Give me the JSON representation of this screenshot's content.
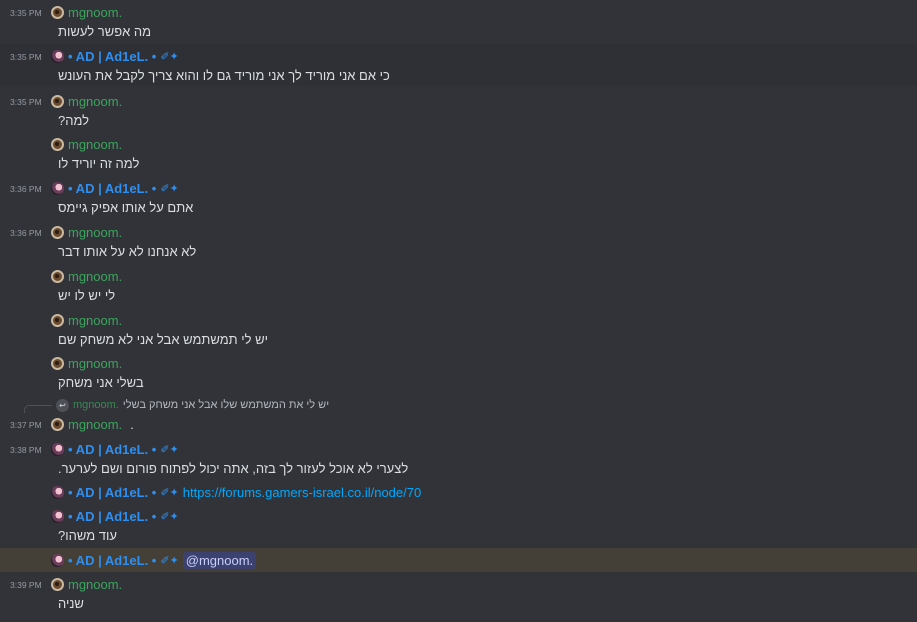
{
  "users": {
    "mg": {
      "name": "mgnoom."
    },
    "ad": {
      "name": "• AD | Ad1eL. •",
      "badge": "✐✦"
    }
  },
  "messages": [
    {
      "time": "3:35 PM",
      "user": "mg",
      "text": "מה אפשר לעשות"
    },
    {
      "time": "3:35 PM",
      "user": "ad",
      "text": "כי אם אני מוריד לך אני מוריד גם לו והוא צריך לקבל את העונש"
    },
    {
      "time": "3:35 PM",
      "user": "mg",
      "text": "למה?"
    },
    {
      "time": "",
      "user": "mg",
      "text": "למה זה יוריד לו"
    },
    {
      "time": "3:36 PM",
      "user": "ad",
      "text": "אתם על אותו אפיק גיימס"
    },
    {
      "time": "3:36 PM",
      "user": "mg",
      "text": "לא אנחנו לא על אותו דבר"
    },
    {
      "time": "",
      "user": "mg",
      "text": "לי יש לו יש"
    },
    {
      "time": "",
      "user": "mg",
      "text": "יש לי תמשתמש אבל אני לא משחק שם"
    },
    {
      "time": "",
      "user": "mg",
      "text": "בשלי אני משחק"
    },
    {
      "time": "3:37 PM",
      "user": "mg",
      "text": ".",
      "reply": {
        "name": "mgnoom.",
        "text": "יש לי את המשתמש שלו אבל אני משחק בשלי"
      }
    },
    {
      "time": "3:38 PM",
      "user": "ad",
      "text": "לצערי לא אוכל לעזור לך בזה, אתה יכול לפתוח פורום ושם לערער."
    },
    {
      "time": "",
      "user": "ad",
      "text": "",
      "inline_link": "https://forums.gamers-israel.co.il/node/70"
    },
    {
      "time": "",
      "user": "ad",
      "text": "עוד משהו?"
    },
    {
      "time": "",
      "user": "ad",
      "text": "",
      "inline_mention": "@mgnoom."
    },
    {
      "time": "3:39 PM",
      "user": "mg",
      "text": "שניה"
    }
  ]
}
